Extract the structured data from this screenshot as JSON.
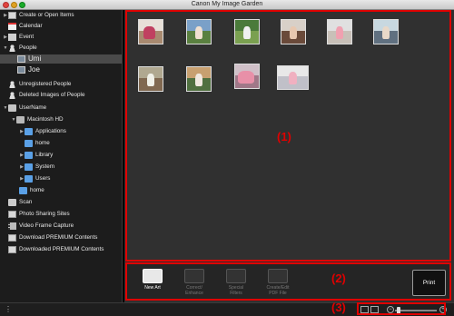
{
  "window": {
    "title": "Canon My Image Garden"
  },
  "sidebar": {
    "items": [
      {
        "label": "Create or Open Items",
        "icon": "items-icon",
        "arrow": "▶"
      },
      {
        "label": "Calendar",
        "icon": "calendar-icon",
        "arrow": ""
      },
      {
        "label": "Event",
        "icon": "event-icon",
        "arrow": "▶"
      },
      {
        "label": "People",
        "icon": "person-icon",
        "arrow": "▼"
      },
      {
        "label": "Umi",
        "icon": "face-thumbnail-icon",
        "arrow": ""
      },
      {
        "label": "Joe",
        "icon": "face-thumbnail-icon",
        "arrow": ""
      },
      {
        "label": "Unregistered People",
        "icon": "person-icon",
        "arrow": ""
      },
      {
        "label": "Deleted Images of People",
        "icon": "person-icon",
        "arrow": ""
      },
      {
        "label": "UserName",
        "icon": "user-folder-icon",
        "arrow": "▼"
      },
      {
        "label": "Macintosh HD",
        "icon": "hard-drive-icon",
        "arrow": "▼"
      },
      {
        "label": "Applications",
        "icon": "folder-icon",
        "arrow": "▶"
      },
      {
        "label": "home",
        "icon": "folder-icon",
        "arrow": ""
      },
      {
        "label": "Library",
        "icon": "folder-icon",
        "arrow": "▶"
      },
      {
        "label": "System",
        "icon": "folder-icon",
        "arrow": "▶"
      },
      {
        "label": "Users",
        "icon": "folder-icon",
        "arrow": "▶"
      },
      {
        "label": "home",
        "icon": "folder-icon",
        "arrow": ""
      },
      {
        "label": "Scan",
        "icon": "scan-icon",
        "arrow": ""
      },
      {
        "label": "Photo Sharing Sites",
        "icon": "photo-sharing-icon",
        "arrow": ""
      },
      {
        "label": "Video Frame Capture",
        "icon": "film-icon",
        "arrow": ""
      },
      {
        "label": "Download PREMIUM Contents",
        "icon": "download-icon",
        "arrow": ""
      },
      {
        "label": "Downloaded PREMIUM Contents",
        "icon": "downloaded-icon",
        "arrow": ""
      }
    ],
    "selected": "Umi"
  },
  "callouts": {
    "area1": "(1)",
    "area2": "(2)",
    "area3": "(3)"
  },
  "toolbar": {
    "buttons": [
      {
        "label": "New Art",
        "state": "active"
      },
      {
        "label": "Correct/ Enhance",
        "state": "disabled"
      },
      {
        "label": "Special Filters",
        "state": "disabled"
      },
      {
        "label": "Create/Edit PDF File",
        "state": "disabled"
      }
    ],
    "print_label": "Print"
  },
  "photos": {
    "count": 10
  },
  "colors": {
    "callout_red": "#e00000",
    "background": "#303030"
  }
}
